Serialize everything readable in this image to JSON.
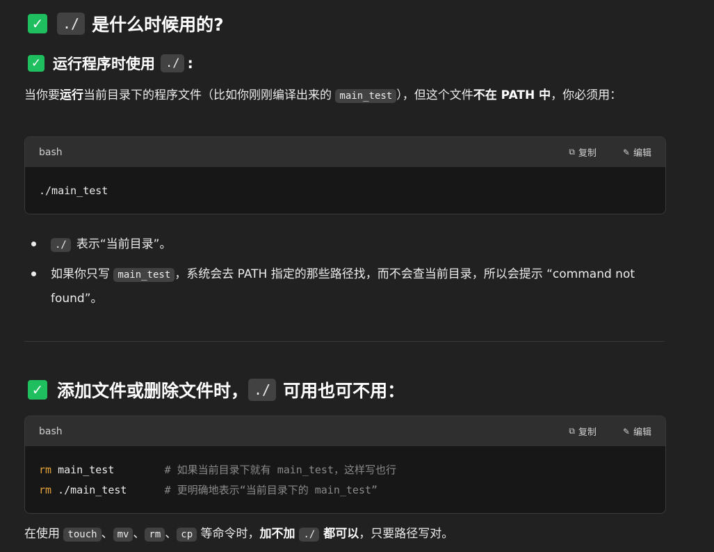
{
  "section1": {
    "check": "✓",
    "code": "./",
    "title": "是什么时候用的?"
  },
  "section2": {
    "check": "✓",
    "title": "运行程序时使用",
    "code": "./",
    "suffix": ":",
    "para": {
      "t1": "当你要",
      "b1": "运行",
      "t2": "当前目录下的程序文件（比如你刚刚编译出来的 ",
      "code": "main_test",
      "t3": "），但这个文件",
      "b2": "不在 PATH 中",
      "t4": "，你必须用："
    },
    "codeblock": {
      "lang": "bash",
      "copy_label": "复制",
      "edit_label": "编辑",
      "line1": "./main_test"
    },
    "bullets": [
      {
        "code": "./",
        "text": "表示“当前目录”。"
      },
      {
        "t1": "如果你只写 ",
        "code": "main_test",
        "t2": "，系统会去 PATH 指定的那些路径找，而不会查当前目录，所以会提示 “command not found”。"
      }
    ]
  },
  "section3": {
    "check": "✓",
    "title": "添加文件或删除文件时，",
    "code": "./",
    "suffix": "可用也可不用：",
    "codeblock": {
      "lang": "bash",
      "copy_label": "复制",
      "edit_label": "编辑",
      "lines": [
        {
          "kw": "rm",
          "arg": " main_test        ",
          "comment": "# 如果当前目录下就有 main_test，这样写也行"
        },
        {
          "kw": "rm",
          "arg": " ./main_test      ",
          "comment": "# 更明确地表示“当前目录下的 main_test”"
        }
      ]
    },
    "para": {
      "t1": "在使用 ",
      "c1": "touch",
      "s1": "、",
      "c2": "mv",
      "s2": "、",
      "c3": "rm",
      "s3": "、",
      "c4": "cp",
      "t2": " 等命令时，",
      "b1": "加不加 ",
      "c5": "./",
      "b2": " 都可以",
      "t3": "，只要路径写对。"
    }
  },
  "icons": {
    "copy": "copy-icon",
    "edit": "edit-icon",
    "check": "check-icon"
  },
  "colors": {
    "background": "#212121",
    "check": "#1fbf5f",
    "keyword": "#e5a33b",
    "comment": "#8a8a8a"
  }
}
